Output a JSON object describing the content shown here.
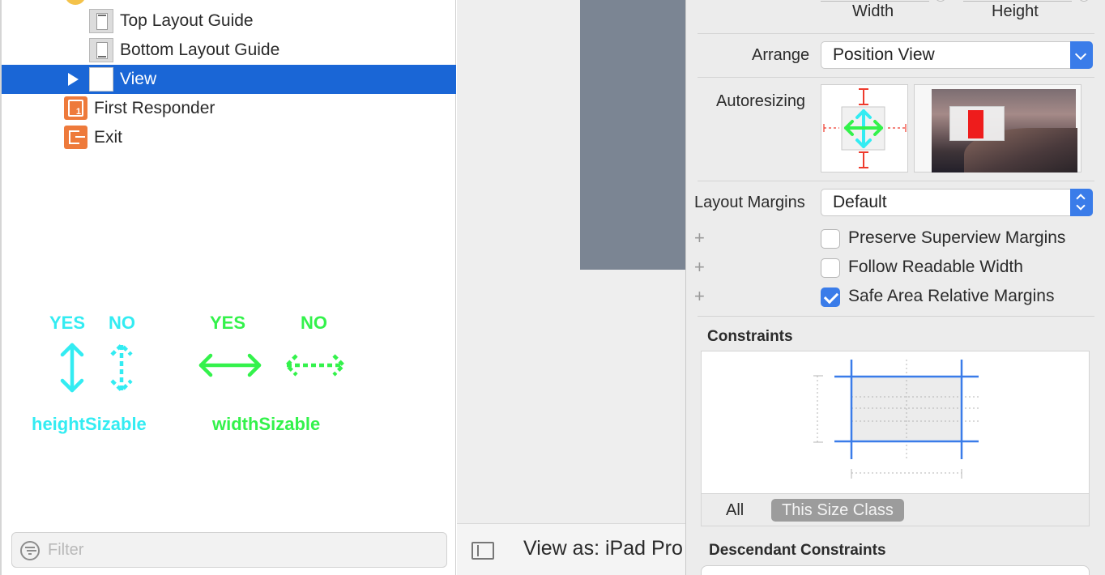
{
  "outline": {
    "items": [
      {
        "label": "Top Layout Guide",
        "icon": "layout-guide-top-icon"
      },
      {
        "label": "Bottom Layout Guide",
        "icon": "layout-guide-bottom-icon"
      },
      {
        "label": "View",
        "icon": "view-icon",
        "selected": true,
        "disclosure": "collapsed"
      },
      {
        "label": "First Responder",
        "icon": "first-responder-icon"
      },
      {
        "label": "Exit",
        "icon": "exit-icon"
      }
    ],
    "filter_placeholder": "Filter"
  },
  "annotations": {
    "height_yes": "YES",
    "height_no": "NO",
    "width_yes": "YES",
    "width_no": "NO",
    "height_caption": "heightSizable",
    "width_caption": "widthSizable",
    "colors": {
      "height": "#33ecf2",
      "width": "#33f24b"
    }
  },
  "canvas": {
    "view_as": "View as: iPad Pro"
  },
  "inspector": {
    "size_labels": {
      "width": "Width",
      "height": "Height"
    },
    "arrange": {
      "label": "Arrange",
      "value": "Position View"
    },
    "autoresizing_label": "Autoresizing",
    "layout_margins": {
      "label": "Layout Margins",
      "value": "Default"
    },
    "checkboxes": [
      {
        "label": "Preserve Superview Margins",
        "checked": false
      },
      {
        "label": "Follow Readable Width",
        "checked": false
      },
      {
        "label": "Safe Area Relative Margins",
        "checked": true
      }
    ],
    "constraints_title": "Constraints",
    "size_class_tabs": {
      "all": "All",
      "this": "This Size Class"
    },
    "descendant_title": "Descendant Constraints",
    "accent": "#3a7ce9",
    "selection": "#1a66d6"
  }
}
